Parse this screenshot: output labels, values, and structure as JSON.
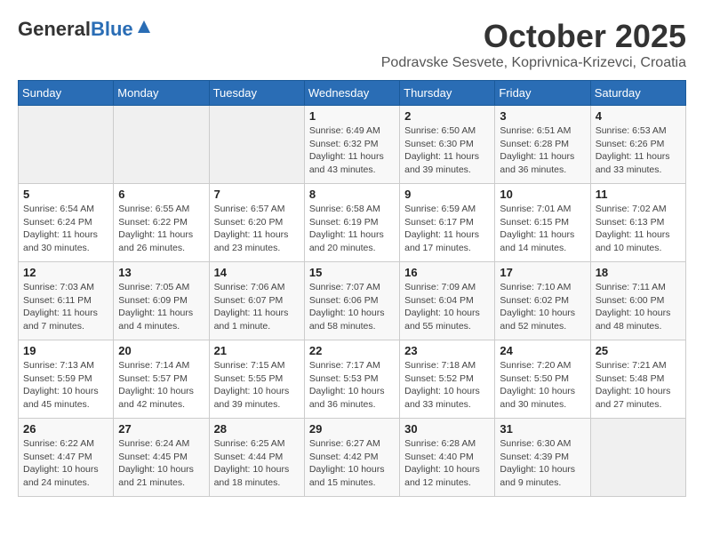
{
  "header": {
    "logo_general": "General",
    "logo_blue": "Blue",
    "month": "October 2025",
    "location": "Podravske Sesvete, Koprivnica-Krizevci, Croatia"
  },
  "weekdays": [
    "Sunday",
    "Monday",
    "Tuesday",
    "Wednesday",
    "Thursday",
    "Friday",
    "Saturday"
  ],
  "weeks": [
    [
      {
        "day": "",
        "info": ""
      },
      {
        "day": "",
        "info": ""
      },
      {
        "day": "",
        "info": ""
      },
      {
        "day": "1",
        "info": "Sunrise: 6:49 AM\nSunset: 6:32 PM\nDaylight: 11 hours and 43 minutes."
      },
      {
        "day": "2",
        "info": "Sunrise: 6:50 AM\nSunset: 6:30 PM\nDaylight: 11 hours and 39 minutes."
      },
      {
        "day": "3",
        "info": "Sunrise: 6:51 AM\nSunset: 6:28 PM\nDaylight: 11 hours and 36 minutes."
      },
      {
        "day": "4",
        "info": "Sunrise: 6:53 AM\nSunset: 6:26 PM\nDaylight: 11 hours and 33 minutes."
      }
    ],
    [
      {
        "day": "5",
        "info": "Sunrise: 6:54 AM\nSunset: 6:24 PM\nDaylight: 11 hours and 30 minutes."
      },
      {
        "day": "6",
        "info": "Sunrise: 6:55 AM\nSunset: 6:22 PM\nDaylight: 11 hours and 26 minutes."
      },
      {
        "day": "7",
        "info": "Sunrise: 6:57 AM\nSunset: 6:20 PM\nDaylight: 11 hours and 23 minutes."
      },
      {
        "day": "8",
        "info": "Sunrise: 6:58 AM\nSunset: 6:19 PM\nDaylight: 11 hours and 20 minutes."
      },
      {
        "day": "9",
        "info": "Sunrise: 6:59 AM\nSunset: 6:17 PM\nDaylight: 11 hours and 17 minutes."
      },
      {
        "day": "10",
        "info": "Sunrise: 7:01 AM\nSunset: 6:15 PM\nDaylight: 11 hours and 14 minutes."
      },
      {
        "day": "11",
        "info": "Sunrise: 7:02 AM\nSunset: 6:13 PM\nDaylight: 11 hours and 10 minutes."
      }
    ],
    [
      {
        "day": "12",
        "info": "Sunrise: 7:03 AM\nSunset: 6:11 PM\nDaylight: 11 hours and 7 minutes."
      },
      {
        "day": "13",
        "info": "Sunrise: 7:05 AM\nSunset: 6:09 PM\nDaylight: 11 hours and 4 minutes."
      },
      {
        "day": "14",
        "info": "Sunrise: 7:06 AM\nSunset: 6:07 PM\nDaylight: 11 hours and 1 minute."
      },
      {
        "day": "15",
        "info": "Sunrise: 7:07 AM\nSunset: 6:06 PM\nDaylight: 10 hours and 58 minutes."
      },
      {
        "day": "16",
        "info": "Sunrise: 7:09 AM\nSunset: 6:04 PM\nDaylight: 10 hours and 55 minutes."
      },
      {
        "day": "17",
        "info": "Sunrise: 7:10 AM\nSunset: 6:02 PM\nDaylight: 10 hours and 52 minutes."
      },
      {
        "day": "18",
        "info": "Sunrise: 7:11 AM\nSunset: 6:00 PM\nDaylight: 10 hours and 48 minutes."
      }
    ],
    [
      {
        "day": "19",
        "info": "Sunrise: 7:13 AM\nSunset: 5:59 PM\nDaylight: 10 hours and 45 minutes."
      },
      {
        "day": "20",
        "info": "Sunrise: 7:14 AM\nSunset: 5:57 PM\nDaylight: 10 hours and 42 minutes."
      },
      {
        "day": "21",
        "info": "Sunrise: 7:15 AM\nSunset: 5:55 PM\nDaylight: 10 hours and 39 minutes."
      },
      {
        "day": "22",
        "info": "Sunrise: 7:17 AM\nSunset: 5:53 PM\nDaylight: 10 hours and 36 minutes."
      },
      {
        "day": "23",
        "info": "Sunrise: 7:18 AM\nSunset: 5:52 PM\nDaylight: 10 hours and 33 minutes."
      },
      {
        "day": "24",
        "info": "Sunrise: 7:20 AM\nSunset: 5:50 PM\nDaylight: 10 hours and 30 minutes."
      },
      {
        "day": "25",
        "info": "Sunrise: 7:21 AM\nSunset: 5:48 PM\nDaylight: 10 hours and 27 minutes."
      }
    ],
    [
      {
        "day": "26",
        "info": "Sunrise: 6:22 AM\nSunset: 4:47 PM\nDaylight: 10 hours and 24 minutes."
      },
      {
        "day": "27",
        "info": "Sunrise: 6:24 AM\nSunset: 4:45 PM\nDaylight: 10 hours and 21 minutes."
      },
      {
        "day": "28",
        "info": "Sunrise: 6:25 AM\nSunset: 4:44 PM\nDaylight: 10 hours and 18 minutes."
      },
      {
        "day": "29",
        "info": "Sunrise: 6:27 AM\nSunset: 4:42 PM\nDaylight: 10 hours and 15 minutes."
      },
      {
        "day": "30",
        "info": "Sunrise: 6:28 AM\nSunset: 4:40 PM\nDaylight: 10 hours and 12 minutes."
      },
      {
        "day": "31",
        "info": "Sunrise: 6:30 AM\nSunset: 4:39 PM\nDaylight: 10 hours and 9 minutes."
      },
      {
        "day": "",
        "info": ""
      }
    ]
  ]
}
